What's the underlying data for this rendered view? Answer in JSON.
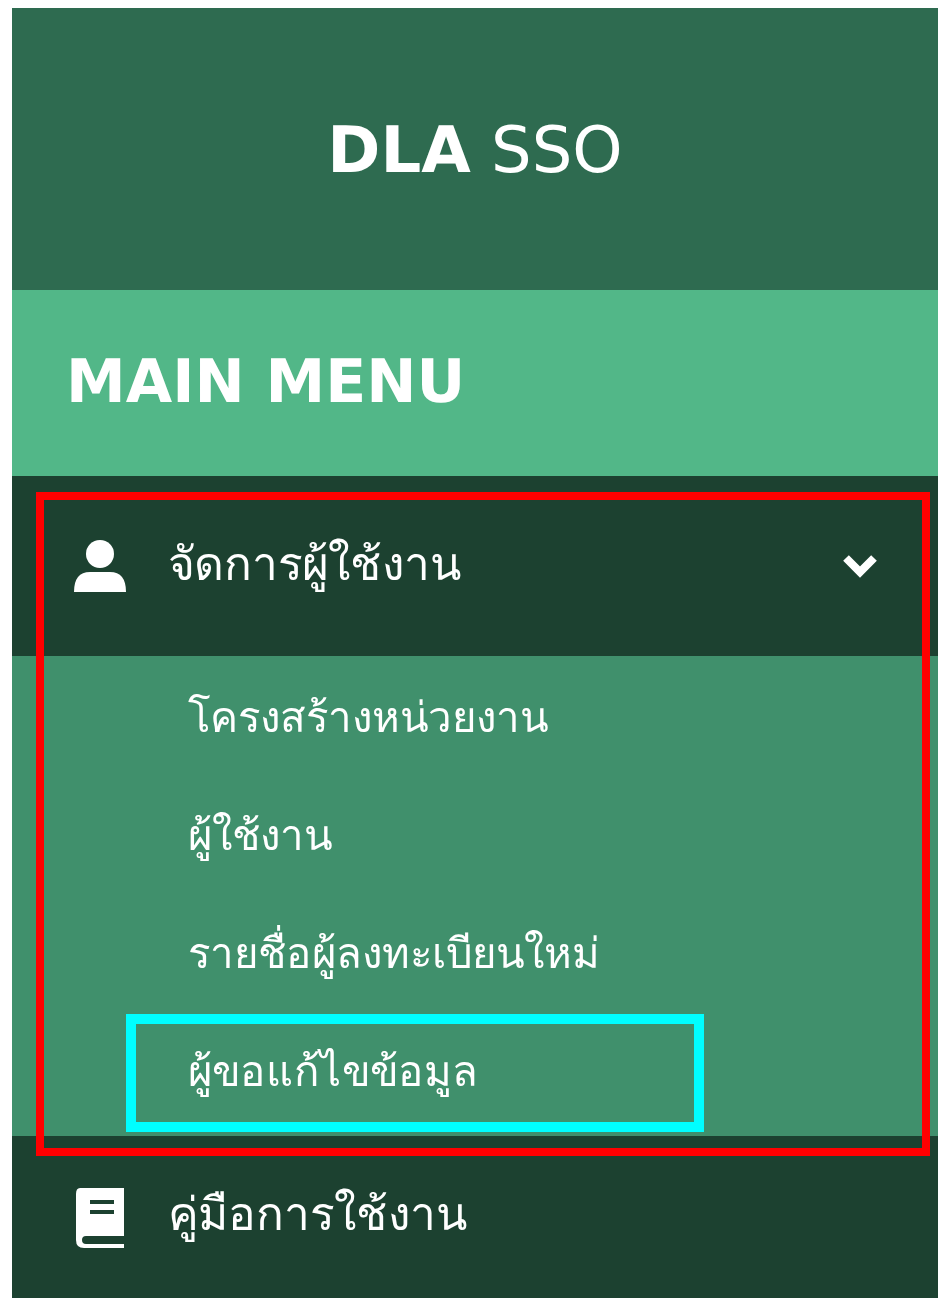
{
  "brand": {
    "bold": "DLA",
    "rest": "SSO"
  },
  "section_title": "MAIN MENU",
  "menu": [
    {
      "kind": "group",
      "label": "จัดการผู้ใช้งาน",
      "expanded": true,
      "annotated": true,
      "children": [
        {
          "label": "โครงสร้างหน่วยงาน",
          "annotated": false
        },
        {
          "label": "ผู้ใช้งาน",
          "annotated": false
        },
        {
          "label": "รายชื่อผู้ลงทะเบียนใหม่",
          "annotated": false
        },
        {
          "label": "ผู้ขอแก้ไขข้อมูล",
          "annotated": true
        }
      ]
    },
    {
      "kind": "link",
      "label": "คู่มือการใช้งาน"
    }
  ]
}
